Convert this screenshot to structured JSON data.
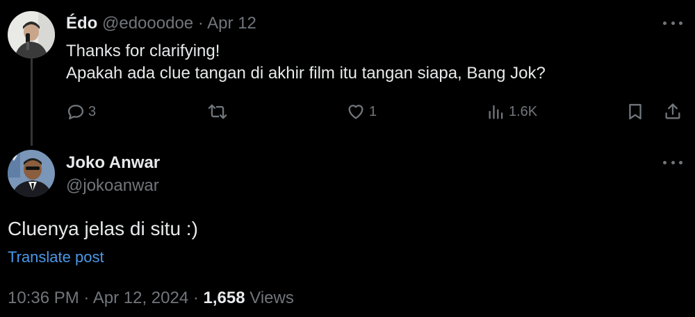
{
  "reply_tweet": {
    "author_name": "Édo",
    "author_handle": "@edooodoe",
    "separator": "·",
    "date": "Apr 12",
    "text_line1": "Thanks for clarifying!",
    "text_line2": "Apakah ada clue tangan di akhir film itu tangan siapa, Bang Jok?",
    "actions": {
      "replies": "3",
      "retweets": "",
      "likes": "1",
      "views": "1.6K"
    }
  },
  "main_tweet": {
    "author_name": "Joko Anwar",
    "author_handle": "@jokoanwar",
    "text": "Cluenya jelas di situ :)",
    "translate_label": "Translate post",
    "time": "10:36 PM",
    "date": "Apr 12, 2024",
    "separator": "·",
    "views_count": "1,658",
    "views_label": "Views"
  },
  "colors": {
    "background": "#000000",
    "primary_text": "#e7e9ea",
    "secondary_text": "#71767b",
    "link": "#4a99e9",
    "thread_line": "#333639"
  },
  "icons": {
    "reply": "reply-icon",
    "retweet": "retweet-icon",
    "like": "heart-icon",
    "views": "views-bar-chart-icon",
    "bookmark": "bookmark-icon",
    "share": "share-icon",
    "more": "more-dots-icon"
  }
}
